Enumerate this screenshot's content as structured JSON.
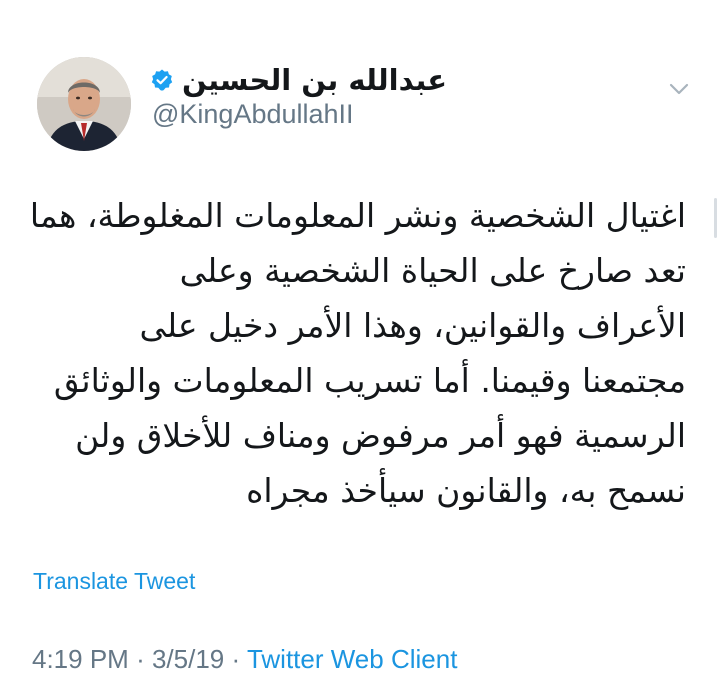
{
  "tweet": {
    "display_name": "عبدالله بن الحسين",
    "handle": "@KingAbdullahII",
    "verified_icon": "verified-badge-icon",
    "menu_icon": "chevron-down-icon",
    "avatar_icon": "profile-photo",
    "text_lines": [
      "اغتيال الشخصية ونشر المعلومات المغلوطة، هما",
      "تعد صارخ على الحياة الشخصية وعلى",
      "الأعراف والقوانين، وهذا الأمر دخيل على",
      "مجتمعنا وقيمنا. أما تسريب المعلومات والوثائق",
      "الرسمية فهو أمر مرفوض ومناف للأخلاق ولن",
      "نسمح به، والقانون سيأخذ مجراه"
    ],
    "translate_label": "Translate Tweet",
    "time": "4:19 PM",
    "separator": "·",
    "date": "3/5/19",
    "client": "Twitter Web Client"
  },
  "colors": {
    "link": "#1b95e0",
    "secondary_text": "#657786",
    "primary_text": "#14171a",
    "verified": "#1da1f2"
  }
}
